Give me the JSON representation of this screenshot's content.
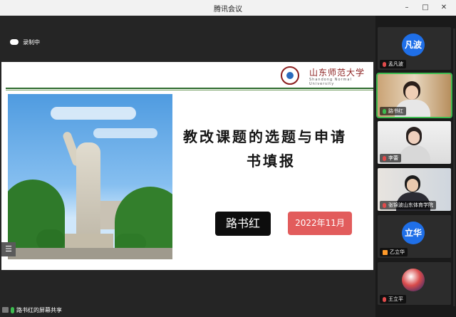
{
  "window": {
    "title": "腾讯会议",
    "controls": [
      "–",
      "□",
      "✕"
    ]
  },
  "recording": {
    "icon": "cloud-record-icon",
    "label": "录制中"
  },
  "slide": {
    "university_name": "山东师范大学",
    "university_name_en": "Shandong Normal University",
    "title_line1": "教改课题的选题与申请",
    "title_line2": "书填报",
    "presenter": "路书红",
    "date": "2022年11月",
    "photo_icon": "statue-photo"
  },
  "share_bar": {
    "label": "路书红的屏幕共享"
  },
  "participants": [
    {
      "name": "孟凡波",
      "avatar_text": "凡波",
      "avatar_color": "#1f6fe8",
      "type": "avatar",
      "mic": "muted"
    },
    {
      "name": "路书红",
      "type": "video",
      "mic": "active"
    },
    {
      "name": "李蕾",
      "type": "video",
      "mic": "muted"
    },
    {
      "name": "张锦波山东体育学院",
      "type": "video",
      "mic": "muted"
    },
    {
      "name": "乙立华",
      "avatar_text": "立华",
      "avatar_color": "#1f6fe8",
      "type": "avatar",
      "mic": "none"
    },
    {
      "name": "王立平",
      "type": "avatar-image",
      "mic": "muted"
    }
  ]
}
